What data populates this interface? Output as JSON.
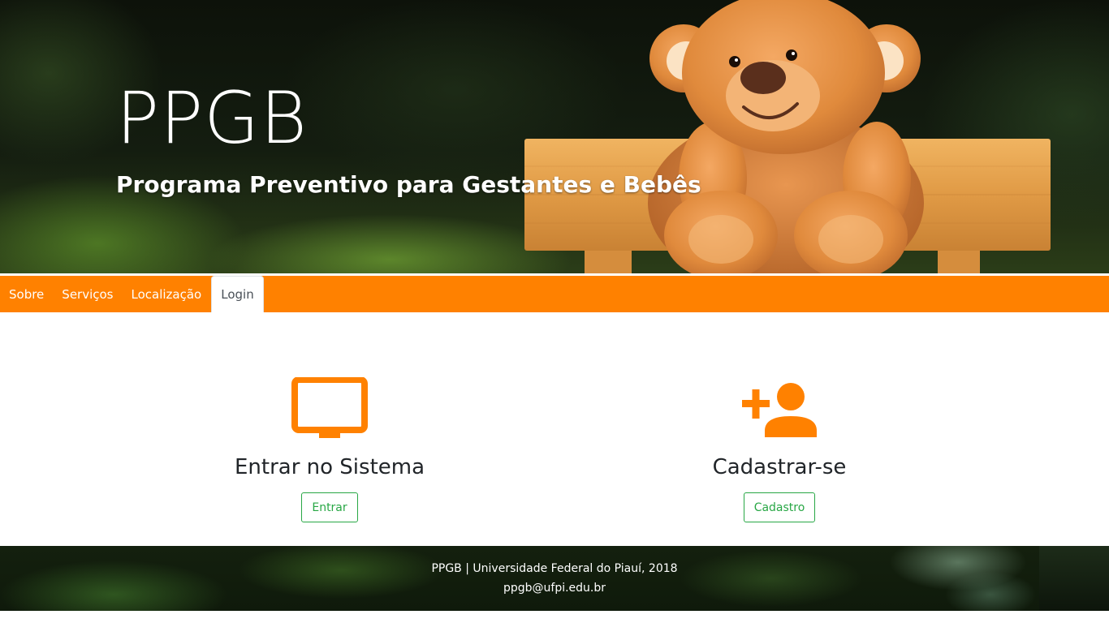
{
  "hero": {
    "title": "PPGB",
    "subtitle": "Programa Preventivo para Gestantes e Bebês"
  },
  "nav": {
    "items": [
      {
        "label": "Sobre",
        "active": false
      },
      {
        "label": "Serviços",
        "active": false
      },
      {
        "label": "Localização",
        "active": false
      },
      {
        "label": "Login",
        "active": true
      }
    ]
  },
  "main": {
    "login_card": {
      "icon": "monitor-icon",
      "title": "Entrar no Sistema",
      "button_label": "Entrar"
    },
    "signup_card": {
      "icon": "add-user-icon",
      "title": "Cadastrar-se",
      "button_label": "Cadastro"
    }
  },
  "footer": {
    "line1": "PPGB | Universidade Federal do Piauí, 2018",
    "line2": "ppgb@ufpi.edu.br"
  },
  "colors": {
    "accent": "#ff8100",
    "button_outline": "#28a745",
    "text_dark": "#212529"
  }
}
